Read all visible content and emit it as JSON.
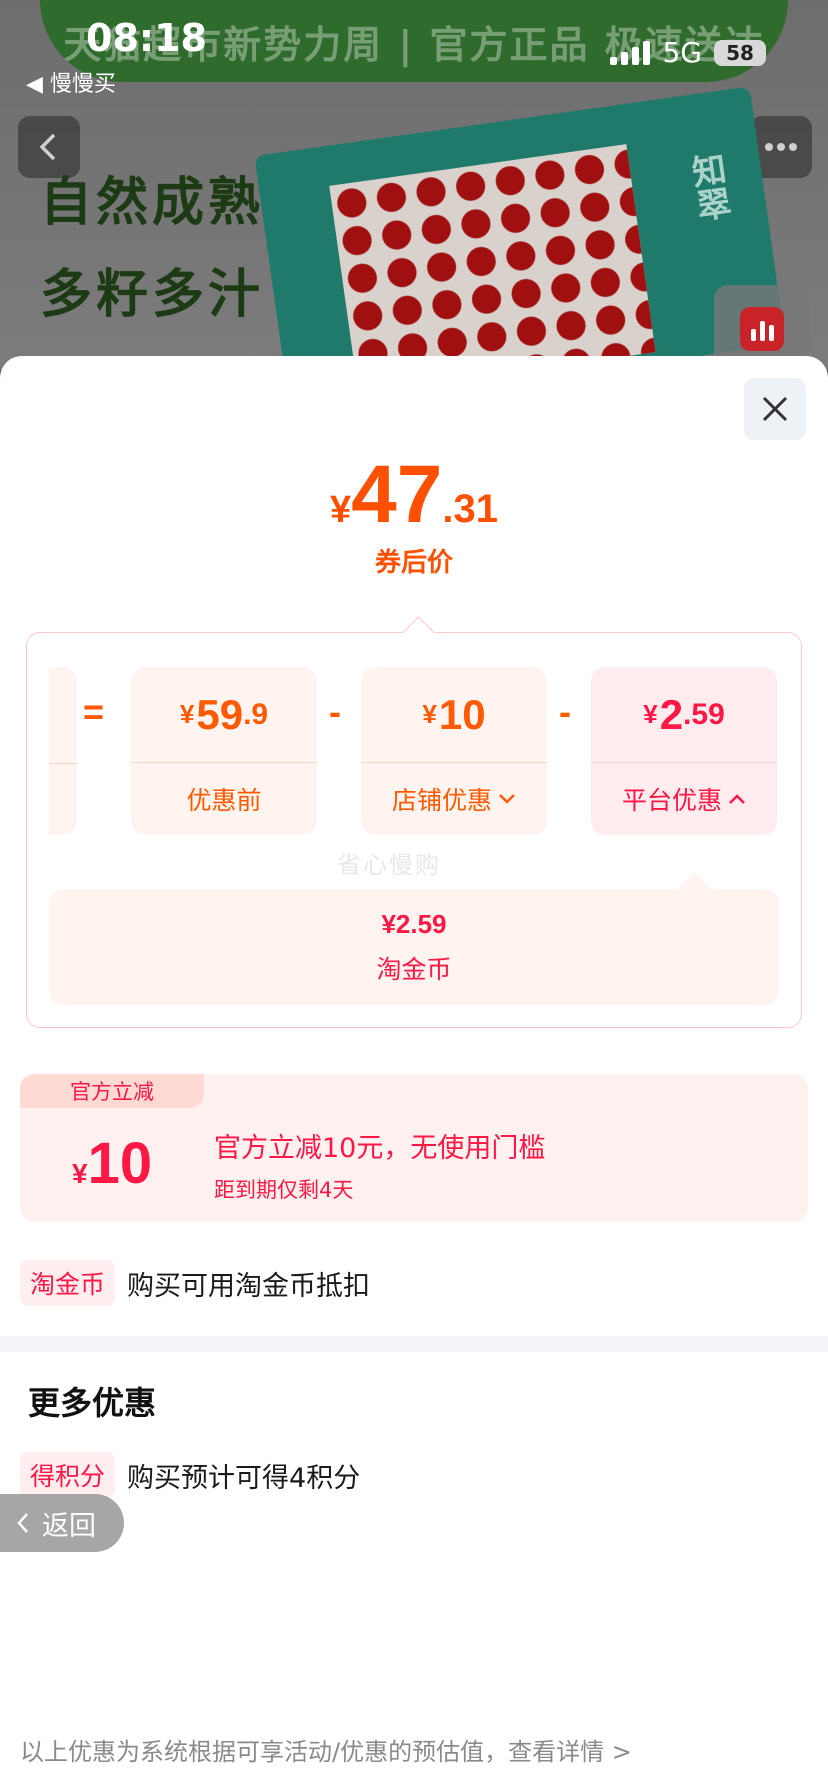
{
  "status_bar": {
    "time": "08:18",
    "back_app": "◀ 慢慢买",
    "network": "5G",
    "battery": "58"
  },
  "banner": {
    "text": "天猫超市新势力周 | 官方正品 极速送达"
  },
  "product": {
    "slogan_line1": "自然成熟",
    "slogan_line2": "多籽多汁",
    "box_label": "知翠"
  },
  "icons": {
    "back": "chevron-left-icon",
    "share": "share-icon",
    "cart": "cart-icon",
    "more": "more-icon",
    "close": "close-icon"
  },
  "sheet": {
    "price": {
      "symbol": "¥",
      "integer": "47",
      "decimal": ".31",
      "label": "券后价"
    },
    "breakdown": {
      "equals": "=",
      "minus": "-",
      "original": {
        "symbol": "¥",
        "integer": "59",
        "decimal": ".9",
        "label": "优惠前"
      },
      "store": {
        "symbol": "¥",
        "integer": "10",
        "decimal": "",
        "label": "店铺优惠"
      },
      "platform": {
        "symbol": "¥",
        "integer": "2",
        "decimal": ".59",
        "label": "平台优惠"
      },
      "watermark": "省心慢购",
      "coin_amount": "¥2.59",
      "coin_label": "淘金币"
    },
    "coupon": {
      "tag": "官方立减",
      "symbol": "¥",
      "amount": "10",
      "title": "官方立减10元，无使用门槛",
      "expire": "距到期仅剩4天"
    },
    "coin_row": {
      "tag": "淘金币",
      "text": "购买可用淘金币抵扣"
    },
    "more_title": "更多优惠",
    "points_row": {
      "tag": "得积分",
      "text": "购买预计可得4积分"
    },
    "back_button": "返回",
    "footer": "以上优惠为系统根据可享活动/优惠的预估值，查看详情 >"
  },
  "colors": {
    "accent_orange": "#ff5000",
    "accent_red": "#ff1745",
    "card_orange_bg": "#fff4ef",
    "card_pink_bg": "#ffecef"
  }
}
